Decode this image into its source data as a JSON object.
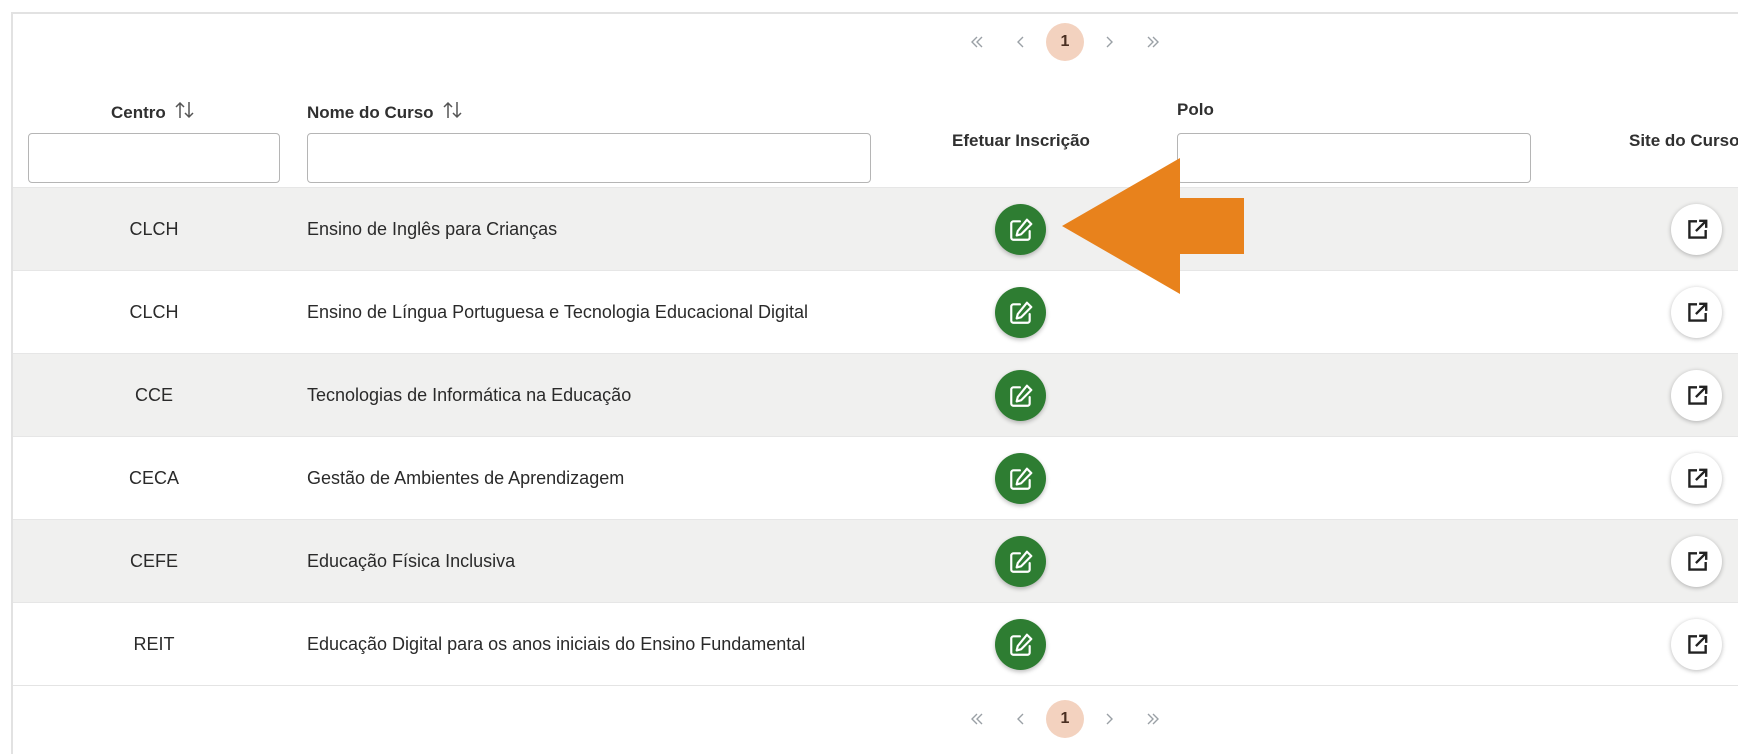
{
  "pagination": {
    "current_page": "1",
    "first_icon": "angle-double-left-icon",
    "prev_icon": "angle-left-icon",
    "next_icon": "angle-right-icon",
    "last_icon": "angle-double-right-icon"
  },
  "columns": {
    "centro": "Centro",
    "curso": "Nome do Curso",
    "inscricao": "Efetuar Inscrição",
    "polo": "Polo",
    "site": "Site do Curso"
  },
  "filters": {
    "centro": "",
    "curso": "",
    "polo": ""
  },
  "rows": [
    {
      "centro": "CLCH",
      "curso": "Ensino de Inglês para Crianças"
    },
    {
      "centro": "CLCH",
      "curso": "Ensino de Língua Portuguesa e Tecnologia Educacional Digital"
    },
    {
      "centro": "CCE",
      "curso": "Tecnologias de Informática na Educação"
    },
    {
      "centro": "CECA",
      "curso": "Gestão de Ambientes de Aprendizagem"
    },
    {
      "centro": "CEFE",
      "curso": "Educação Física Inclusiva"
    },
    {
      "centro": "REIT",
      "curso": "Educação Digital para os anos iniciais do Ensino Fundamental"
    }
  ],
  "colors": {
    "inscricao_button": "#2e7d32",
    "active_page": "#f3d2bf",
    "annotation_arrow": "#e8821c",
    "striped_row": "#f0f0ef"
  }
}
